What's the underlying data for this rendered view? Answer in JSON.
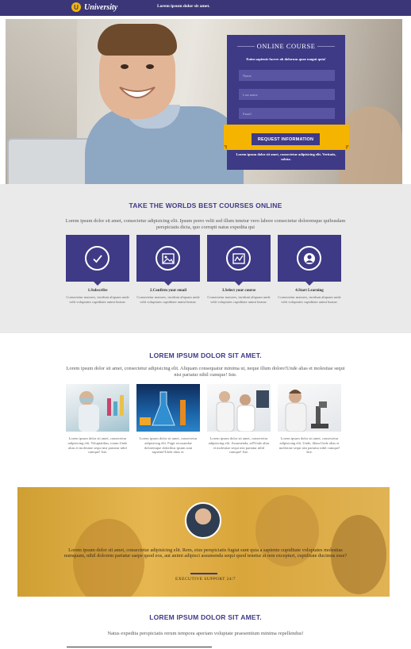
{
  "header": {
    "logo_mark": "U",
    "brand": "University",
    "tagline": "Lorem ipsum dolor sit amet."
  },
  "hero_form": {
    "title": "ONLINE COURSE",
    "subtitle": "Enim sapiente facere ab dolorum quae magni quia!",
    "name_placeholder": "Name",
    "lastname_placeholder": "Last name",
    "email_placeholder": "Email",
    "button_label": "REQUEST INFORMATION",
    "footer_text": "Lorem ipsum dolor sit amet, consectetur adipisicing elit. Veritatis, soluta."
  },
  "steps_section": {
    "title": "TAKE THE WORLDS BEST COURSES ONLINE",
    "intro": "Lorem ipsum dolor sit amet, consectetur adipisicing elit. Ipsum porro velit sed illum tenetur vero labore consectetur doloremque quibusdam perspiciatis dicta, quo corrupti natus expedita qui",
    "steps": [
      {
        "icon": "check-icon",
        "title": "1.Subscribe",
        "desc": "Consectetur maiores, incidunt aliquam unde velit voluptates cupiditate animi beatae."
      },
      {
        "icon": "image-icon",
        "title": "2.Confirm your email",
        "desc": "Consectetur maiores, incidunt aliquam unde velit voluptates cupiditate animi beatae."
      },
      {
        "icon": "chart-icon",
        "title": "3.Select your course",
        "desc": "Consectetur maiores, incidunt aliquam unde velit voluptates cupiditate animi beatae."
      },
      {
        "icon": "user-icon",
        "title": "4.Start Learning",
        "desc": "Consectetur maiores, incidunt aliquam unde velit voluptates cupiditate animi beatae."
      }
    ]
  },
  "labs_section": {
    "title": "LOREM IPSUM DOLOR SIT AMET.",
    "intro": "Lorem ipsum dolor sit amet, consectetur adipisicing elit. Aliquam consequatur minima ut, neque illum dolore!Unde alias et molestiae sequi nisi pariatur nihil cumque! Iste.",
    "items": [
      {
        "desc": "Lorem ipsum dolor sit amet, consectetur adipisicing elit. Voluptatibus, totam.Unde alias et molestiae sequi nisi pariatur nihil cumque! Iste."
      },
      {
        "desc": "Lorem ipsum dolor sit amet, consectetur adipisicing elit. Fugit recusandae doloremque doloribus ipsum sunt sapiente!Unde alias et."
      },
      {
        "desc": "Lorem ipsum dolor sit amet, consectetur adipisicing elit. Assumenda, ad!Unde alias et molestiae sequi nisi pariatur nihil cumque! Iste."
      },
      {
        "desc": "Lorem ipsum dolor sit amet, consectetur adipisicing elit. Unde, illum.Unde alias et molestiae sequi nisi pariatur nihil cumque! Iste."
      }
    ]
  },
  "testimonial": {
    "quote": "Lorem ipsum dolor sit amet, consectetur adipisicing elit. Rem, eius perspiciatis fugiat sunt quia a sapiente cupiditate voluptates molestias numquam, nihil dolorem pariatur saepe quod eos, aut animi adipisci assumenda sequi quod tenetur at non excepturi, cupiditate ducimus esse?",
    "author": "EXECUTIVE SUPPORT 24/7"
  },
  "last_section": {
    "title": "LOREM IPSUM DOLOR SIT AMET.",
    "subtitle": "Natus expedita perspiciatis rerum tempora aperiam voluptate praesentium minima repellendus!"
  },
  "colors": {
    "brand_purple": "#3e3a86",
    "accent_yellow": "#f5b400"
  }
}
